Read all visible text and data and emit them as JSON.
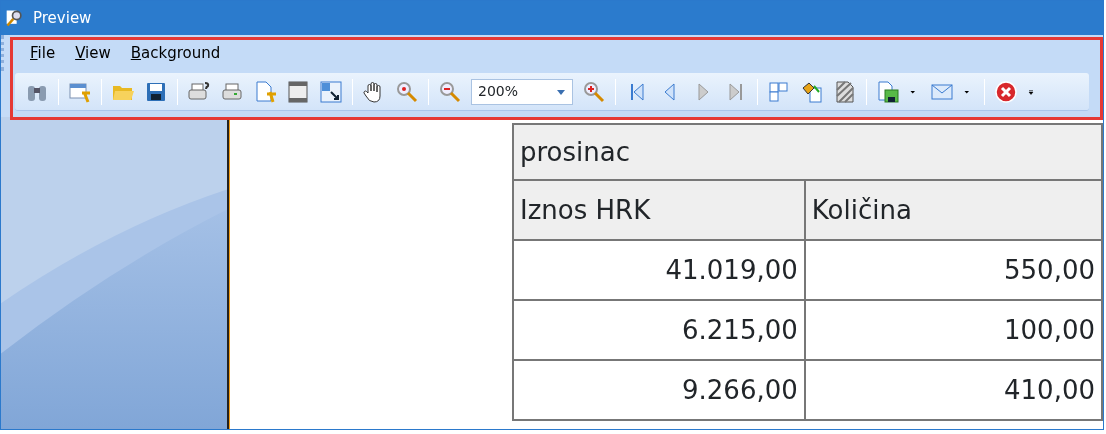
{
  "window": {
    "title": "Preview"
  },
  "menu": [
    {
      "label": "File"
    },
    {
      "label": "View"
    },
    {
      "label": "Background"
    }
  ],
  "toolbar": {
    "zoom": {
      "value": "200%"
    }
  },
  "table": {
    "group": "prosinac",
    "columns": [
      "Iznos HRK",
      "Količina"
    ],
    "rows": [
      [
        "41.019,00",
        "550,00"
      ],
      [
        "6.215,00",
        "100,00"
      ],
      [
        "9.266,00",
        "410,00"
      ]
    ]
  }
}
